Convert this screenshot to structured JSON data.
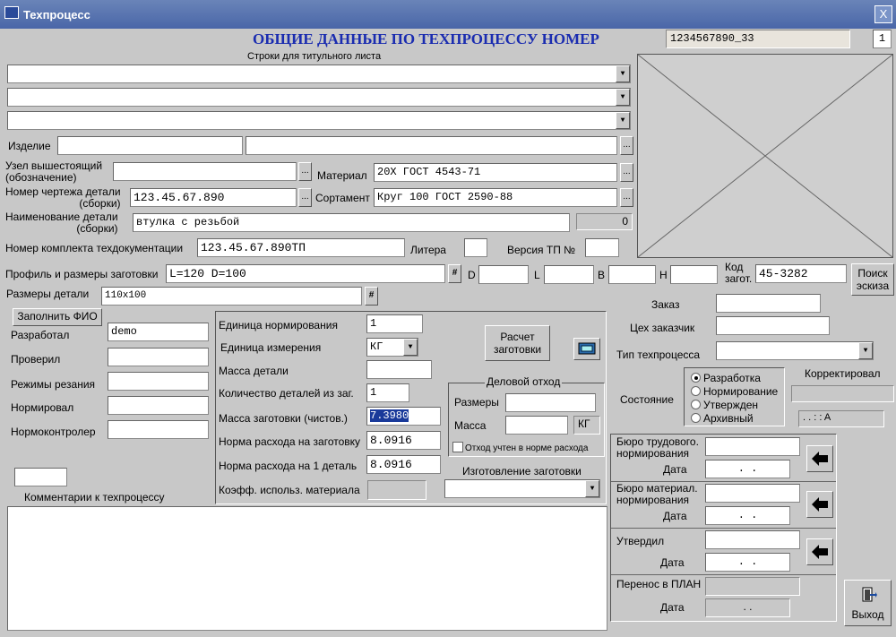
{
  "window": {
    "title": "Техпроцесс",
    "close": "X"
  },
  "header": {
    "title": "ОБЩИЕ ДАННЫЕ ПО ТЕХПРОЦЕССУ НОМЕР",
    "number": "1234567890_33",
    "page": "1"
  },
  "title_lines": {
    "label": "Строки для титульного листа",
    "lines": [
      "",
      "",
      ""
    ]
  },
  "fields": {
    "izdelie_label": "Изделие",
    "izdelie_code": "",
    "izdelie_name": "",
    "uzel_label": "Узел вышестоящий\n(обозначение)",
    "uzel": "",
    "material_label": "Материал",
    "material": "20Х ГОСТ 4543-71",
    "chertezh_label": "Номер чертежа детали\n(сборки)",
    "chertezh": "123.45.67.890",
    "sortament_label": "Сортамент",
    "sortament": "Круг 100 ГОСТ 2590-88",
    "naim_label": "Наименование детали\n(сборки)",
    "naim": "втулка с резьбой",
    "naim_count": "0",
    "komplekt_label": "Номер комплекта техдокументации",
    "komplekt": "123.45.67.890ТП",
    "litera_label": "Литера",
    "litera": "",
    "versiya_label": "Версия ТП №",
    "versiya": "",
    "profil_label": "Профиль и размеры заготовки",
    "profil": "L=120  D=100",
    "d_label": "D",
    "l_label": "L",
    "b_label": "B",
    "h_label": "H",
    "kod_label": "Код\nзагот.",
    "kod": "45-3282",
    "razmery_label": "Размеры детали",
    "razmery": "110x100",
    "hash": "#",
    "ellipsis": "..."
  },
  "buttons": {
    "poisk": "Поиск\nэскиза",
    "zapolnit": "Заполнить ФИО",
    "raschet": "Расчет\nзаготовки",
    "vyhod": "Выход"
  },
  "people": {
    "razrabotal_label": "Разработал",
    "razrabotal": "demo",
    "proveril_label": "Проверил",
    "rezhimy_label": "Режимы резания",
    "normiroval_label": "Нормировал",
    "normokontroler_label": "Нормоконтролер"
  },
  "norm": {
    "ed_norm_label": "Единица нормирования",
    "ed_norm": "1",
    "ed_izm_label": "Единица измерения",
    "ed_izm": "КГ",
    "massa_det_label": "Масса детали",
    "massa_det": "",
    "kol_label": "Количество деталей из заг.",
    "kol": "1",
    "massa_zag_label": "Масса заготовки  (чистов.)",
    "massa_zag": "7.3980",
    "norma_zag_label": "Норма расхода на заготовку",
    "norma_zag": "8.0916",
    "norma_det_label": "Норма расхода на 1 деталь",
    "norma_det": "8.0916",
    "koeff_label": "Коэфф. использ. материала",
    "koeff": ""
  },
  "otkhod": {
    "title": "Деловой отход",
    "razmery_label": "Размеры",
    "massa_label": "Масса",
    "unit": "КГ",
    "check_label": "Отход учтен в норме расхода"
  },
  "izgotovlenie": {
    "label": "Изготовление заготовки",
    "value": ""
  },
  "comments": {
    "label": "Комментарии к техпроцессу",
    "text": ""
  },
  "right": {
    "zakaz_label": "Заказ",
    "zakaz": "",
    "tseh_label": "Цех заказчик",
    "tseh": "",
    "tip_label": "Тип техпроцесса",
    "tip": "",
    "sostoyanie_label": "Состояние",
    "states": [
      "Разработка",
      "Нормирование",
      "Утвержден",
      "Архивный"
    ],
    "selected": "Разработка",
    "korrekt_label": "Корректировал",
    "korrekt_date": ". .       :  :  A"
  },
  "approvals": [
    {
      "label": "Бюро трудового.\nнормирования",
      "date_label": "Дата",
      "date": ".  ."
    },
    {
      "label": "Бюро материал.\nнормирования",
      "date_label": "Дата",
      "date": ".  ."
    },
    {
      "label": "Утвердил",
      "date_label": "Дата",
      "date": ".  ."
    },
    {
      "label": "Перенос в ПЛАН",
      "date_label": "Дата",
      "date": ".  ."
    }
  ],
  "colors": {
    "header_title": "#1a2cb0",
    "titlebar": "#4a66a8",
    "selection": "#1a3a9a"
  }
}
